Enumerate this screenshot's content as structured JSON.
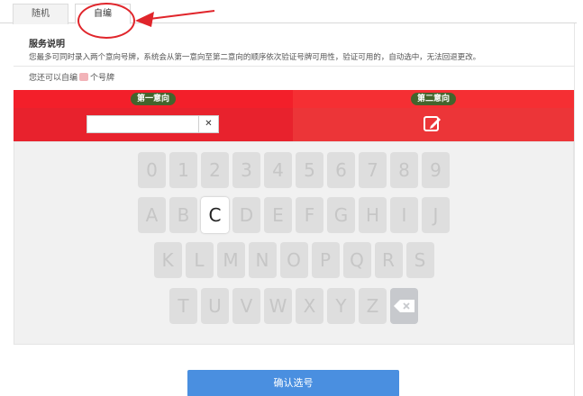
{
  "tabs": [
    {
      "label": "随机"
    },
    {
      "label": "自编"
    }
  ],
  "info": {
    "title": "服务说明",
    "text": "您最多可同时录入两个意向号牌，系统会从第一意向至第二意向的顺序依次验证号牌可用性，验证可用的，自动选中，无法回退更改。",
    "hint_before": "您还可以自编",
    "hint_after": "个号牌"
  },
  "intentions": {
    "first_label": "第一意向",
    "second_label": "第二意向",
    "first_value": ""
  },
  "keyboard": {
    "row1": [
      "0",
      "1",
      "2",
      "3",
      "4",
      "5",
      "6",
      "7",
      "8",
      "9"
    ],
    "row2": [
      "A",
      "B",
      "C",
      "D",
      "E",
      "F",
      "G",
      "H",
      "I",
      "J"
    ],
    "row3": [
      "K",
      "L",
      "M",
      "N",
      "O",
      "P",
      "Q",
      "R",
      "S"
    ],
    "row4": [
      "T",
      "U",
      "V",
      "W",
      "X",
      "Y",
      "Z"
    ],
    "active_key": "C"
  },
  "confirm_label": "确认选号",
  "colors": {
    "accent_red": "#e8222d",
    "badge_green": "#44642c",
    "confirm_blue": "#4a8fe0"
  }
}
